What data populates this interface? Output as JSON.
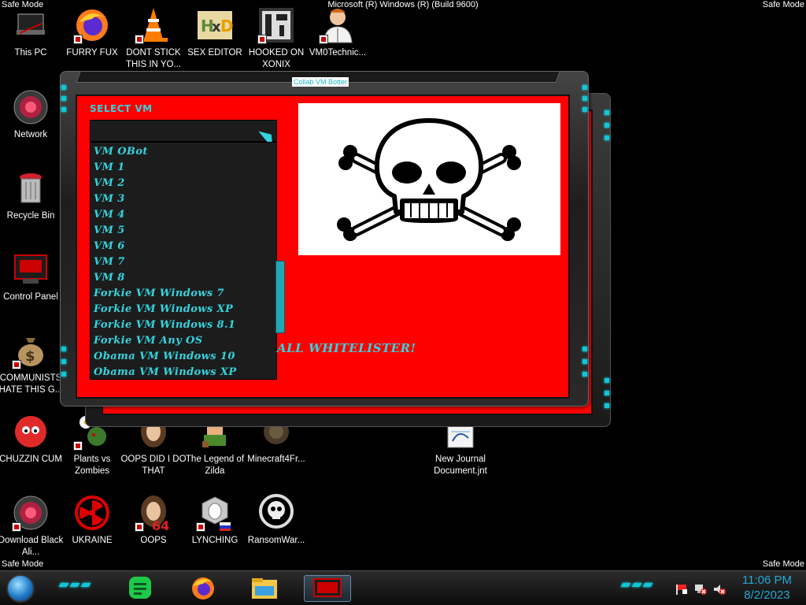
{
  "os": {
    "safe_mode": "Safe Mode",
    "build_title": "Microsoft (R) Windows (R) (Build 9600)"
  },
  "desktop_icons": [
    {
      "label": "This PC",
      "icon": "computer-icon"
    },
    {
      "label": "FURRY FUX",
      "icon": "firefox-icon"
    },
    {
      "label": "DONT STICK THIS IN YO...",
      "icon": "traffic-cone-icon"
    },
    {
      "label": "SEX EDITOR",
      "icon": "hex-editor-icon"
    },
    {
      "label": "HOOKED ON XONIX",
      "icon": "xonix-game-icon"
    },
    {
      "label": "VM0Technic...",
      "icon": "doctor-icon"
    },
    {
      "label": "Network",
      "icon": "network-icon"
    },
    {
      "label": "Recycle Bin",
      "icon": "recycle-bin-icon"
    },
    {
      "label": "Control Panel",
      "icon": "control-panel-icon"
    },
    {
      "label": "COMMUNISTS HATE THIS G...",
      "icon": "money-bag-icon"
    },
    {
      "label": "CHUZZIN CUM",
      "icon": "chuzzle-icon"
    },
    {
      "label": "Plants vs Zombies",
      "icon": "plants-vs-zombies-icon"
    },
    {
      "label": "OOPS DID I DO THAT",
      "icon": "portrait-icon"
    },
    {
      "label": "The Legend of Zilda",
      "icon": "zelda-icon"
    },
    {
      "label": "Minecraft4Fr...",
      "icon": "minecraft-icon"
    },
    {
      "label": "New Journal Document.jnt",
      "icon": "journal-document-icon"
    },
    {
      "label": "Download Black Ali...",
      "icon": "download-icon"
    },
    {
      "label": "UKRAINE",
      "icon": "radiation-icon"
    },
    {
      "label": "OOPS",
      "icon": "portrait-64-icon"
    },
    {
      "label": "LYNCHING",
      "icon": "noose-icon"
    },
    {
      "label": "RansomWar...",
      "icon": "skull-icon"
    }
  ],
  "window": {
    "title": "Collab VM Botter",
    "select_label": "SELECT VM",
    "combo_value": "",
    "options": [
      "VM OBot",
      "VM 1",
      "VM 2",
      "VM 3",
      "VM 4",
      "VM 5",
      "VM 6",
      "VM 7",
      "VM 8",
      "Forkie VM Windows 7",
      "Forkie VM Windows XP",
      "Forkie VM Windows 8.1",
      "Forkie VM Any OS",
      "Obama VM Windows 10",
      "Obama VM Windows XP"
    ],
    "image": "skull-and-crossbones",
    "whitelister_text": "ALL WHITELISTER!"
  },
  "taskbar": {
    "apps": [
      {
        "name": "notes-app-icon"
      },
      {
        "name": "firefox-icon"
      },
      {
        "name": "file-explorer-icon"
      },
      {
        "name": "active-window-icon"
      }
    ],
    "tray": [
      "flag-icon",
      "network-error-icon",
      "volume-muted-icon"
    ],
    "time": "11:06 PM",
    "date": "8/2/2023"
  },
  "colors": {
    "accent": "#33d4de",
    "client_bg": "#ff0000",
    "clock": "#22a9d6"
  }
}
